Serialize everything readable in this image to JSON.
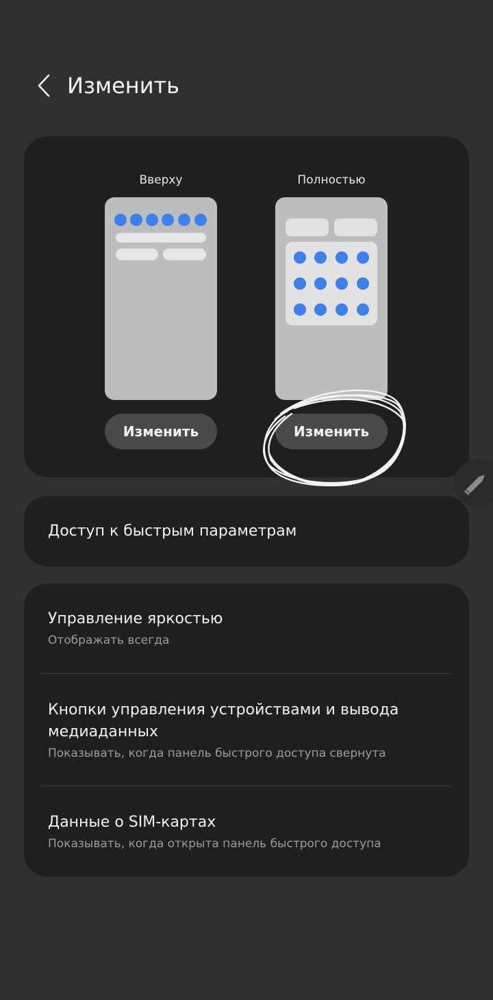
{
  "header": {
    "title": "Изменить",
    "back_icon": "chevron-left-icon"
  },
  "layout": {
    "options": [
      {
        "label": "Вверху",
        "button": "Изменить"
      },
      {
        "label": "Полностью",
        "button": "Изменить"
      }
    ],
    "accent": "#3a80ee"
  },
  "quick_access": {
    "title": "Доступ к быстрым параметрам"
  },
  "settings": {
    "items": [
      {
        "title": "Управление яркостью",
        "subtitle": "Отображать всегда"
      },
      {
        "title": "Кнопки управления устройствами и вывода медиаданных",
        "subtitle": "Показывать, когда панель быстрого доступа свернута"
      },
      {
        "title": "Данные о SIM-картах",
        "subtitle": "Показывать, когда открыта панель быстрого доступа"
      }
    ]
  },
  "floating": {
    "icon": "pencil-icon"
  }
}
